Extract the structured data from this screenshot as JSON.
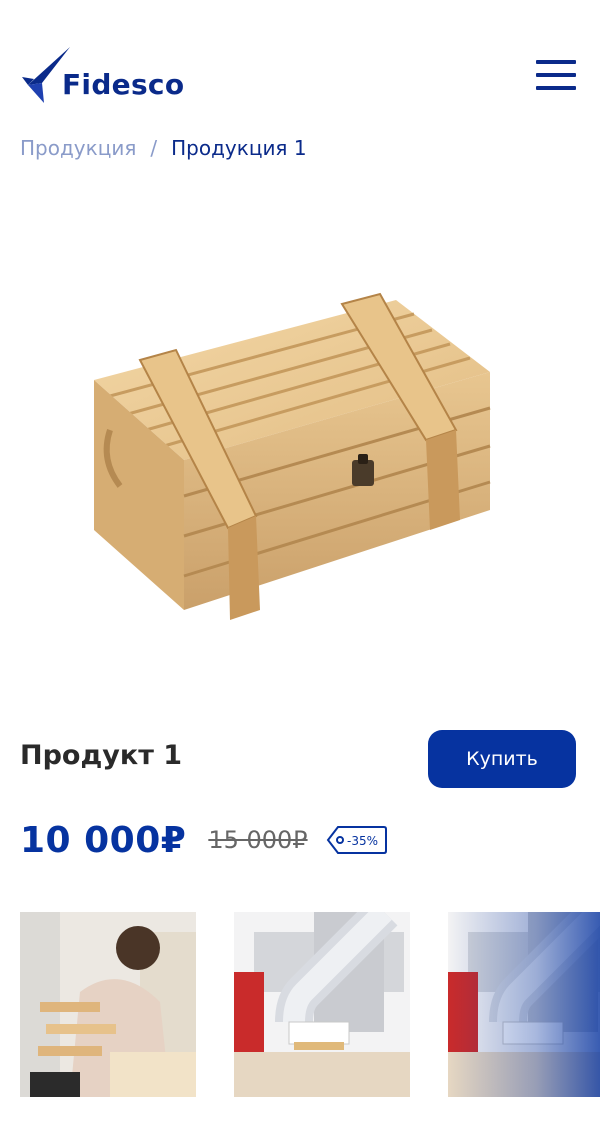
{
  "header": {
    "brand": "Fidesco",
    "logo_icon": "fidesco-bird-logo",
    "menu_icon": "hamburger-icon"
  },
  "breadcrumb": {
    "items": [
      "Продукция"
    ],
    "separator": "/",
    "current": "Продукция 1"
  },
  "product": {
    "title": "Продукт 1",
    "buy_label": "Купить",
    "price_current": "10 000₽",
    "price_old": "15 000₽",
    "discount": "-35%"
  },
  "gallery": {
    "thumbs": [
      "woman-woodworking-photo",
      "cnc-machine-photo",
      "cnc-machine-photo-faded"
    ]
  },
  "colors": {
    "brand": "#0a2a8a",
    "accent": "#0633a0",
    "muted": "#8a9bc9"
  }
}
